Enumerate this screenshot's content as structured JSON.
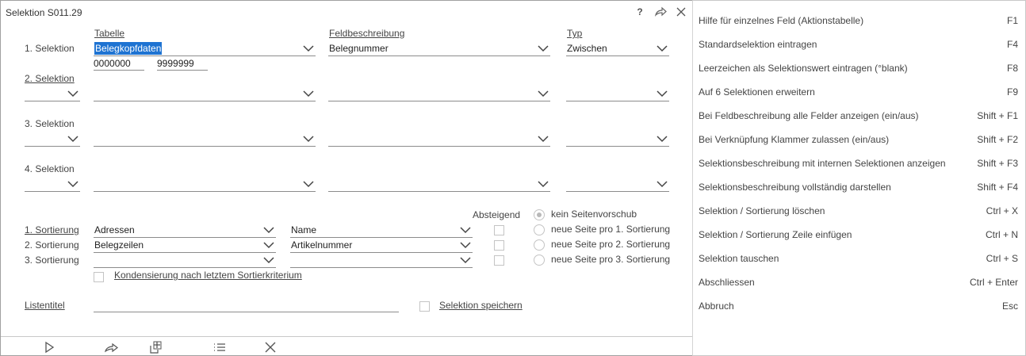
{
  "dialog": {
    "title": "Selektion S011.29",
    "col_headers": {
      "tabelle": "Tabelle",
      "feldbeschreibung": "Feldbeschreibung",
      "typ": "Typ"
    },
    "selections": [
      {
        "label": "1. Selektion",
        "tabelle": "Belegkopfdaten",
        "feld": "Belegnummer",
        "typ": "Zwischen",
        "von": "0000000",
        "bis": "9999999"
      },
      {
        "label": "2. Selektion",
        "tabelle": "",
        "feld": "",
        "typ": ""
      },
      {
        "label": "3. Selektion",
        "tabelle": "",
        "feld": "",
        "typ": ""
      },
      {
        "label": "4. Selektion",
        "tabelle": "",
        "feld": "",
        "typ": ""
      }
    ],
    "absteigend_label": "Absteigend",
    "sorts": [
      {
        "label": "1. Sortierung",
        "tabelle": "Adressen",
        "feld": "Name",
        "radio_label": "kein Seitenvorschub"
      },
      {
        "label": "2. Sortierung",
        "tabelle": "Belegzeilen",
        "feld": "Artikelnummer",
        "radio_label": "neue Seite pro 1. Sortierung"
      },
      {
        "label": "3. Sortierung",
        "tabelle": "",
        "feld": "",
        "radio_label": "neue Seite pro 2. Sortierung"
      }
    ],
    "extra_radio_label": "neue Seite pro 3. Sortierung",
    "kondensierung_label": "Kondensierung nach letztem Sortierkriterium",
    "listentitel_label": "Listentitel",
    "listentitel_value": "",
    "selektion_speichern_label": "Selektion speichern"
  },
  "help": [
    {
      "label": "Hilfe für einzelnes Feld (Aktionstabelle)",
      "key": "F1"
    },
    {
      "label": "Standardselektion eintragen",
      "key": "F4"
    },
    {
      "label": "Leerzeichen als Selektionswert eintragen (°blank)",
      "key": "F8"
    },
    {
      "label": "Auf 6 Selektionen erweitern",
      "key": "F9"
    },
    {
      "label": "Bei Feldbeschreibung alle Felder anzeigen (ein/aus)",
      "key": "Shift + F1"
    },
    {
      "label": "Bei Verknüpfung Klammer zulassen (ein/aus)",
      "key": "Shift + F2"
    },
    {
      "label": "Selektionsbeschreibung mit internen Selektionen anzeigen",
      "key": "Shift + F3"
    },
    {
      "label": "Selektionsbeschreibung vollständig darstellen",
      "key": "Shift + F4"
    },
    {
      "label": "Selektion / Sortierung löschen",
      "key": "Ctrl + X"
    },
    {
      "label": "Selektion / Sortierung Zeile einfügen",
      "key": "Ctrl + N"
    },
    {
      "label": "Selektion tauschen",
      "key": "Ctrl + S"
    },
    {
      "label": "Abschliessen",
      "key": "Ctrl + Enter"
    },
    {
      "label": "Abbruch",
      "key": "Esc"
    }
  ]
}
